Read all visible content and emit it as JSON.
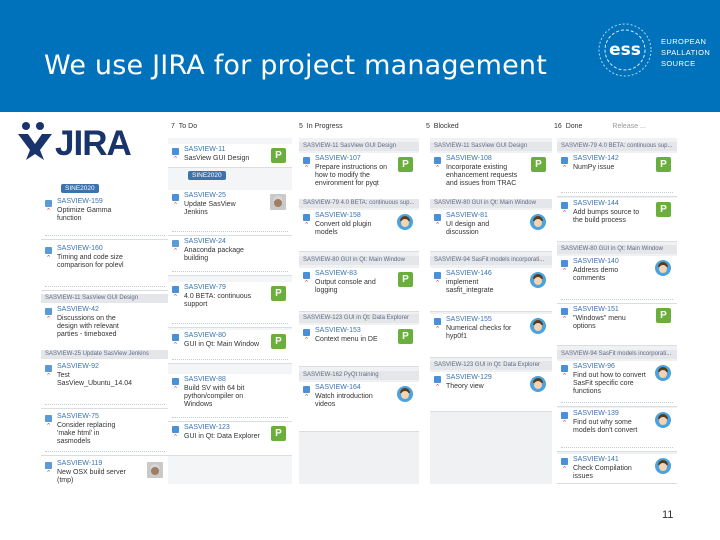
{
  "slide": {
    "title": "We use JIRA for project management",
    "page_number": "11",
    "org_lines": [
      "EUROPEAN",
      "SPALLATION",
      "SOURCE"
    ],
    "org_logo_text": "ess",
    "tool_name": "JIRA"
  },
  "colors": {
    "banner": "#0072bc",
    "jira_text": "#19336b",
    "issue_key": "#3b73af",
    "p_badge": "#6aaf3d",
    "priority": "#d04437"
  },
  "board": {
    "columns": [
      {
        "count": "7",
        "name": "To Do"
      },
      {
        "count": "5",
        "name": "In Progress"
      },
      {
        "count": "5",
        "name": "Blocked"
      },
      {
        "count": "16",
        "name": "Done",
        "extra": "Release ..."
      }
    ],
    "epic_labels": [
      "SINE2020",
      "SINE2020"
    ],
    "swimlanes": {
      "l11": "SASVIEW-11   SasView GUI Design",
      "l79": "SASVIEW-79   4.0 BETA: continuous sup...",
      "l80": "SASVIEW-80   GUI in Qt: Main Window",
      "l94": "SASVIEW-94   SasFit models incorporati...",
      "l25": "SASVIEW-25   Update SasView Jenkins",
      "l123": "SASVIEW-123   GUI in Qt: Data Explorer",
      "l162": "SASVIEW-162   PyQt training"
    },
    "todo": [
      {
        "key": "SASVIEW-11",
        "summary": "SasView GUI Design"
      },
      {
        "key": "SASVIEW-25",
        "summary": "Update SasView Jenkins"
      },
      {
        "key": "SASVIEW-24",
        "summary": "Anaconda package building"
      },
      {
        "key": "SASVIEW-79",
        "summary": "4.0 BETA: continuous support"
      },
      {
        "key": "SASVIEW-80",
        "summary": "GUI in Qt: Main Window"
      },
      {
        "key": "SASVIEW-88",
        "summary": "Build SV with 64 bit python/compiler on Windows"
      },
      {
        "key": "SASVIEW-123",
        "summary": "GUI in Qt: Data Explorer"
      }
    ],
    "side": [
      {
        "key": "SASVIEW-159",
        "summary": "Optimize Gamma function"
      },
      {
        "key": "SASVIEW-160",
        "summary": "Timing and code size comparison for polevl"
      },
      {
        "key": "SASVIEW-42",
        "summary": "Discussions on the design with relevant parties - timeboxed"
      },
      {
        "key": "SASVIEW-92",
        "summary": "Test SasView_Ubuntu_14.04"
      },
      {
        "key": "SASVIEW-75",
        "summary": "Consider replacing 'make html' in sasmodels"
      },
      {
        "key": "SASVIEW-119",
        "summary": "New OSX build server (tmp)"
      }
    ],
    "in_progress": [
      {
        "key": "SASVIEW-107",
        "summary": "Prepare instructions on how to modify the environment for pyqt"
      },
      {
        "key": "SASVIEW-158",
        "summary": "Convert old plugin models"
      },
      {
        "key": "SASVIEW-83",
        "summary": "Output console and logging"
      },
      {
        "key": "SASVIEW-153",
        "summary": "Context menu in DE"
      },
      {
        "key": "SASVIEW-164",
        "summary": "Watch introduction videos"
      }
    ],
    "blocked": [
      {
        "key": "SASVIEW-108",
        "summary": "Incorporate existing enhancement requests and issues from TRAC"
      },
      {
        "key": "SASVIEW-81",
        "summary": "UI design and discussion"
      },
      {
        "key": "SASVIEW-146",
        "summary": "implement sasfit_integrate"
      },
      {
        "key": "SASVIEW-155",
        "summary": "Numerical checks for hyp0f1"
      },
      {
        "key": "SASVIEW-129",
        "summary": "Theory view"
      }
    ],
    "done": [
      {
        "key": "SASVIEW-142",
        "summary": "NumPy issue"
      },
      {
        "key": "SASVIEW-144",
        "summary": "Add bumps source to the build process"
      },
      {
        "key": "SASVIEW-140",
        "summary": "Address demo comments"
      },
      {
        "key": "SASVIEW-151",
        "summary": "\"Windows\" menu options"
      },
      {
        "key": "SASVIEW-96",
        "summary": "Find out how to convert SasFit specific core functions"
      },
      {
        "key": "SASVIEW-139",
        "summary": "Find out why some models don't convert"
      },
      {
        "key": "SASVIEW-141",
        "summary": "Check Compilation issues"
      }
    ]
  }
}
